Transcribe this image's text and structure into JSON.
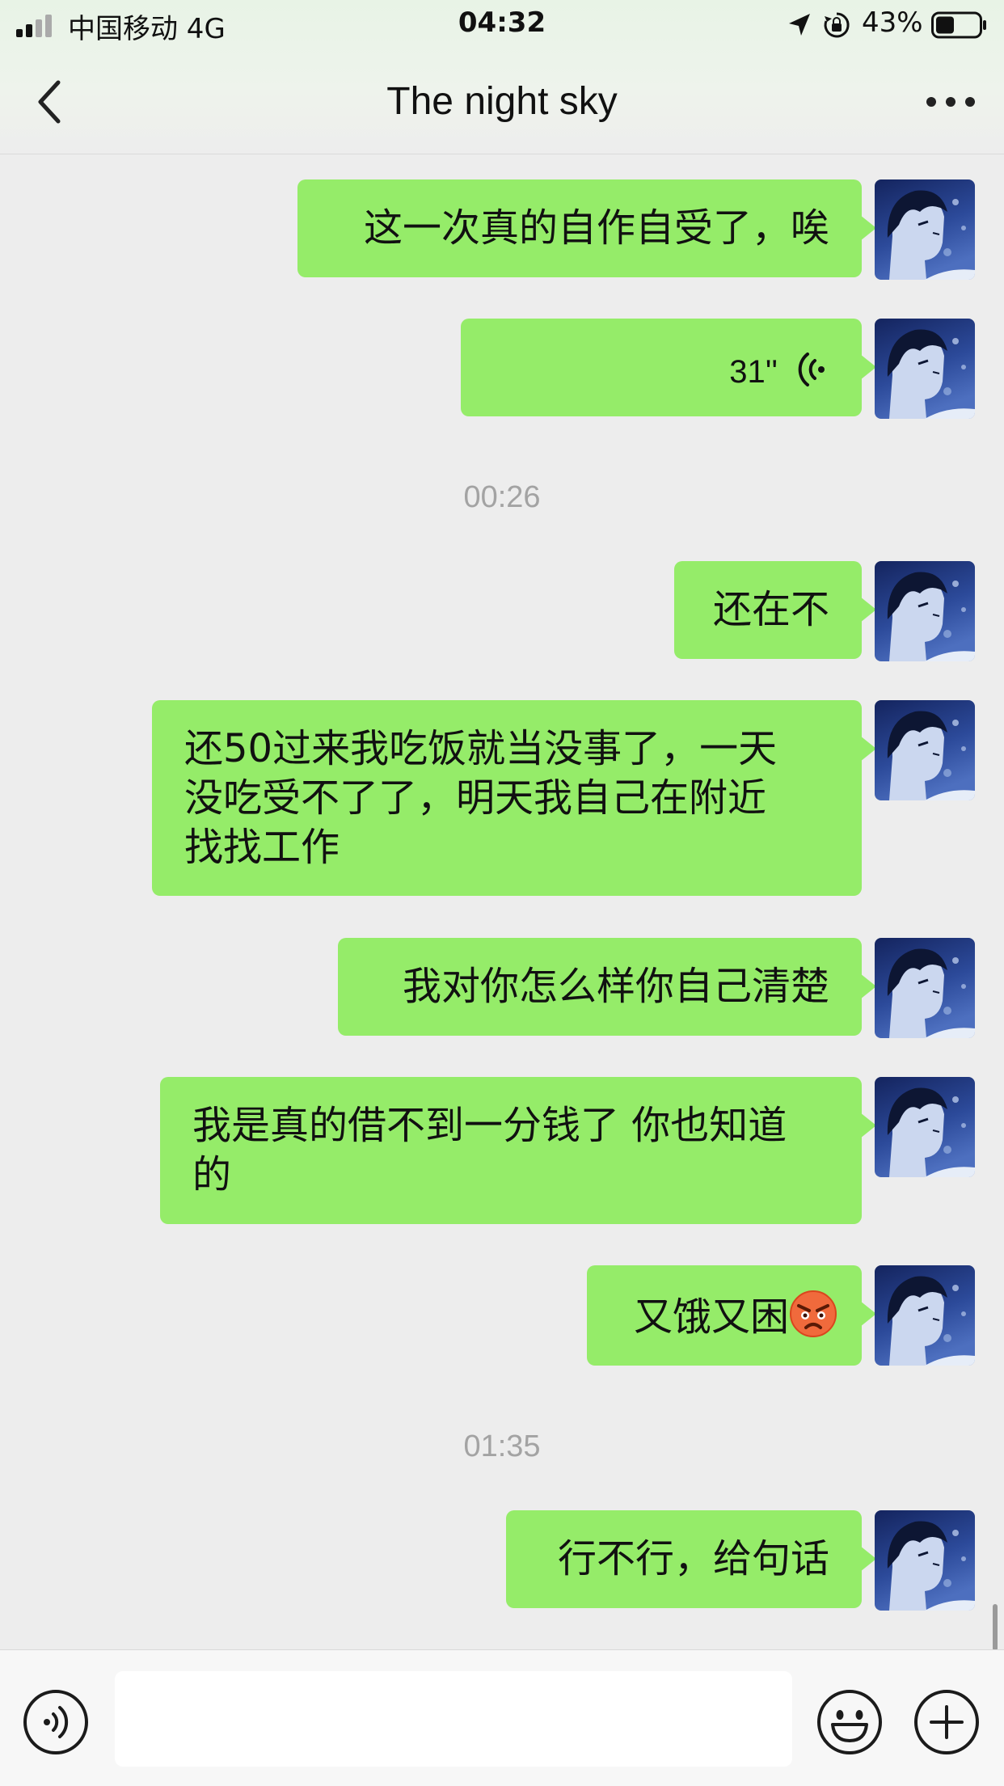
{
  "status_bar": {
    "carrier": "中国移动  4G",
    "time": "04:32",
    "battery": "43%",
    "icons": [
      "signal-icon",
      "location-icon",
      "rotation-lock-icon",
      "battery-icon"
    ]
  },
  "header": {
    "title": "The night sky",
    "icons": [
      "back-icon",
      "more-icon"
    ]
  },
  "messages": [
    {
      "type": "text",
      "text": "这一次真的自作自受了，唉"
    },
    {
      "type": "voice",
      "duration": "31''"
    },
    {
      "type": "timestamp",
      "text": "00:26"
    },
    {
      "type": "text",
      "text": "还在不"
    },
    {
      "type": "text",
      "lines": [
        "还50过来我吃饭就当没事了，一天",
        "没吃受不了了，明天我自己在附近",
        "找找工作"
      ]
    },
    {
      "type": "text",
      "text": "我对你怎么样你自己清楚"
    },
    {
      "type": "text",
      "lines": [
        "我是真的借不到一分钱了 你也知道",
        "的"
      ]
    },
    {
      "type": "text",
      "text": "又饿又困",
      "emoji": "angry-face-emoji"
    },
    {
      "type": "timestamp",
      "text": "01:35"
    },
    {
      "type": "text",
      "text": "行不行，给句话"
    }
  ],
  "input_bar": {
    "placeholder": "",
    "icons": [
      "voice-input-icon",
      "emoji-icon",
      "plus-icon"
    ]
  },
  "colors": {
    "bubble": "#95ec69",
    "background": "#ededed",
    "timestamp": "#a3a3a3"
  }
}
